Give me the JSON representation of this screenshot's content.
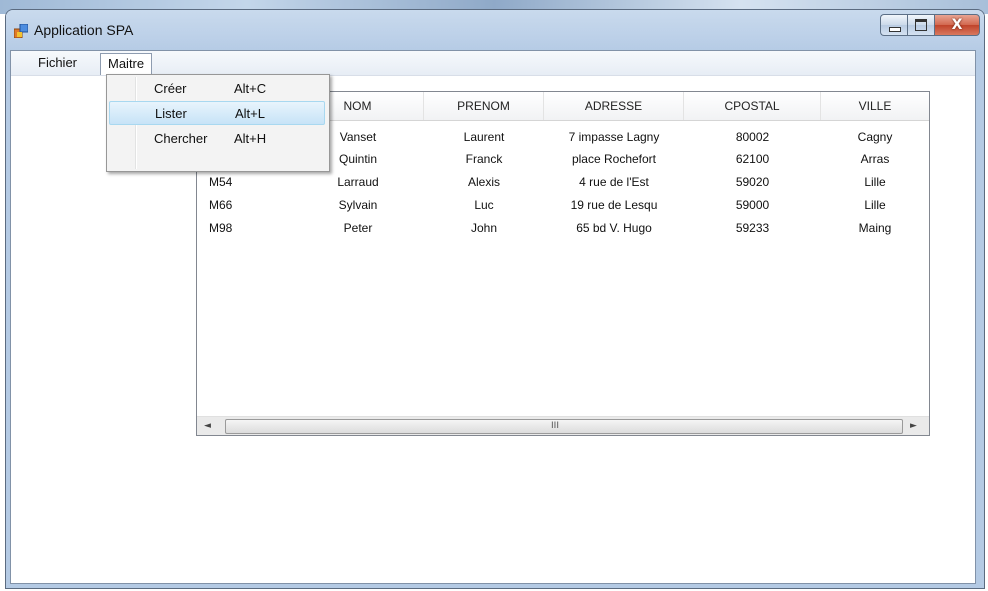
{
  "window": {
    "title": "Application SPA",
    "controls": {
      "minimize_icon": "minimize-icon",
      "maximize_icon": "maximize-icon",
      "close_label": "X"
    }
  },
  "menubar": {
    "fichier": "Fichier",
    "maitre": "Maitre"
  },
  "dropdown": {
    "items": [
      {
        "label": "Créer",
        "shortcut": "Alt+C",
        "highlighted": false
      },
      {
        "label": "Lister",
        "shortcut": "Alt+L",
        "highlighted": true
      },
      {
        "label": "Chercher",
        "shortcut": "Alt+H",
        "highlighted": false
      }
    ]
  },
  "grid": {
    "columns": [
      "",
      "NOM",
      "PRENOM",
      "ADRESSE",
      "CPOSTAL",
      "VILLE"
    ],
    "rows": [
      [
        "",
        "Vanset",
        "Laurent",
        "7 impasse Lagny",
        "80002",
        "Cagny"
      ],
      [
        "",
        "Quintin",
        "Franck",
        "place Rochefort",
        "62100",
        "Arras"
      ],
      [
        "M54",
        "Larraud",
        "Alexis",
        "4 rue de l'Est",
        "59020",
        "Lille"
      ],
      [
        "M66",
        "Sylvain",
        "Luc",
        "19 rue de Lesqu",
        "59000",
        "Lille"
      ],
      [
        "M98",
        "Peter",
        "John",
        "65 bd V. Hugo",
        "59233",
        "Maing"
      ]
    ],
    "scroll_grip": "III",
    "scroll_left": "◄",
    "scroll_right": "►"
  },
  "colors": {
    "highlight": "#c7e3f7",
    "titlebar": "#bcd0e8",
    "close": "#c0432a"
  }
}
